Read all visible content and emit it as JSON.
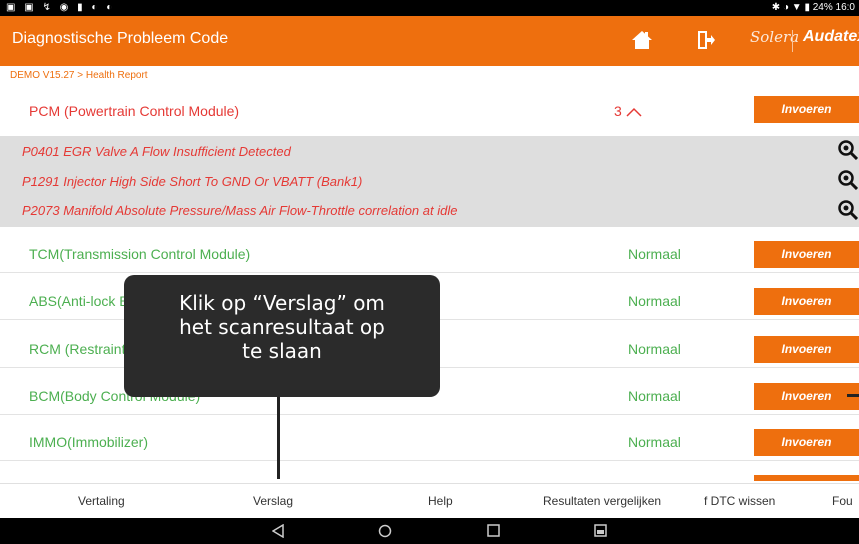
{
  "statusbar": {
    "time": "16:0",
    "battery": "24%"
  },
  "header": {
    "title": "Diagnostische Probleem Code",
    "brand1": "Solera",
    "brand2": "Audatex"
  },
  "breadcrumb": "DEMO V15.27 > Health Report",
  "modules": [
    {
      "name": "PCM (Powertrain Control Module)",
      "status": "3",
      "button": "Invoeren"
    },
    {
      "name": "TCM(Transmission Control Module)",
      "status": "Normaal",
      "button": "Invoeren"
    },
    {
      "name": "ABS(Anti-lock B",
      "status": "Normaal",
      "button": "Invoeren"
    },
    {
      "name": "RCM (Restraint",
      "status": "Normaal",
      "button": "Invoeren"
    },
    {
      "name": "BCM(Body Control Module)",
      "status": "Normaal",
      "button": "Invoeren"
    },
    {
      "name": "IMMO(Immobilizer)",
      "status": "Normaal",
      "button": "Invoeren"
    }
  ],
  "dtcs": [
    "P0401 EGR Valve A Flow Insufficient Detected",
    "P1291 Injector High Side Short To GND Or VBATT (Bank1)",
    "P2073 Manifold Absolute Pressure/Mass Air Flow-Throttle correlation at idle"
  ],
  "tooltip": {
    "line1": "Klik op “Verslag” om",
    "line2": "het scanresultaat op",
    "line3": "te slaan"
  },
  "bottom": {
    "translate": "Vertaling",
    "report": "Verslag",
    "help": "Help",
    "compare": "Resultaten vergelijken",
    "clear": "f DTC wissen",
    "more": "Fou"
  },
  "icons": {
    "home": "home-icon",
    "exit": "exit-icon",
    "magnifier": "magnifier-icon",
    "back": "nav-back-icon",
    "homeNav": "nav-home-icon",
    "recent": "nav-recents-icon",
    "screenshot": "nav-screenshot-icon"
  }
}
